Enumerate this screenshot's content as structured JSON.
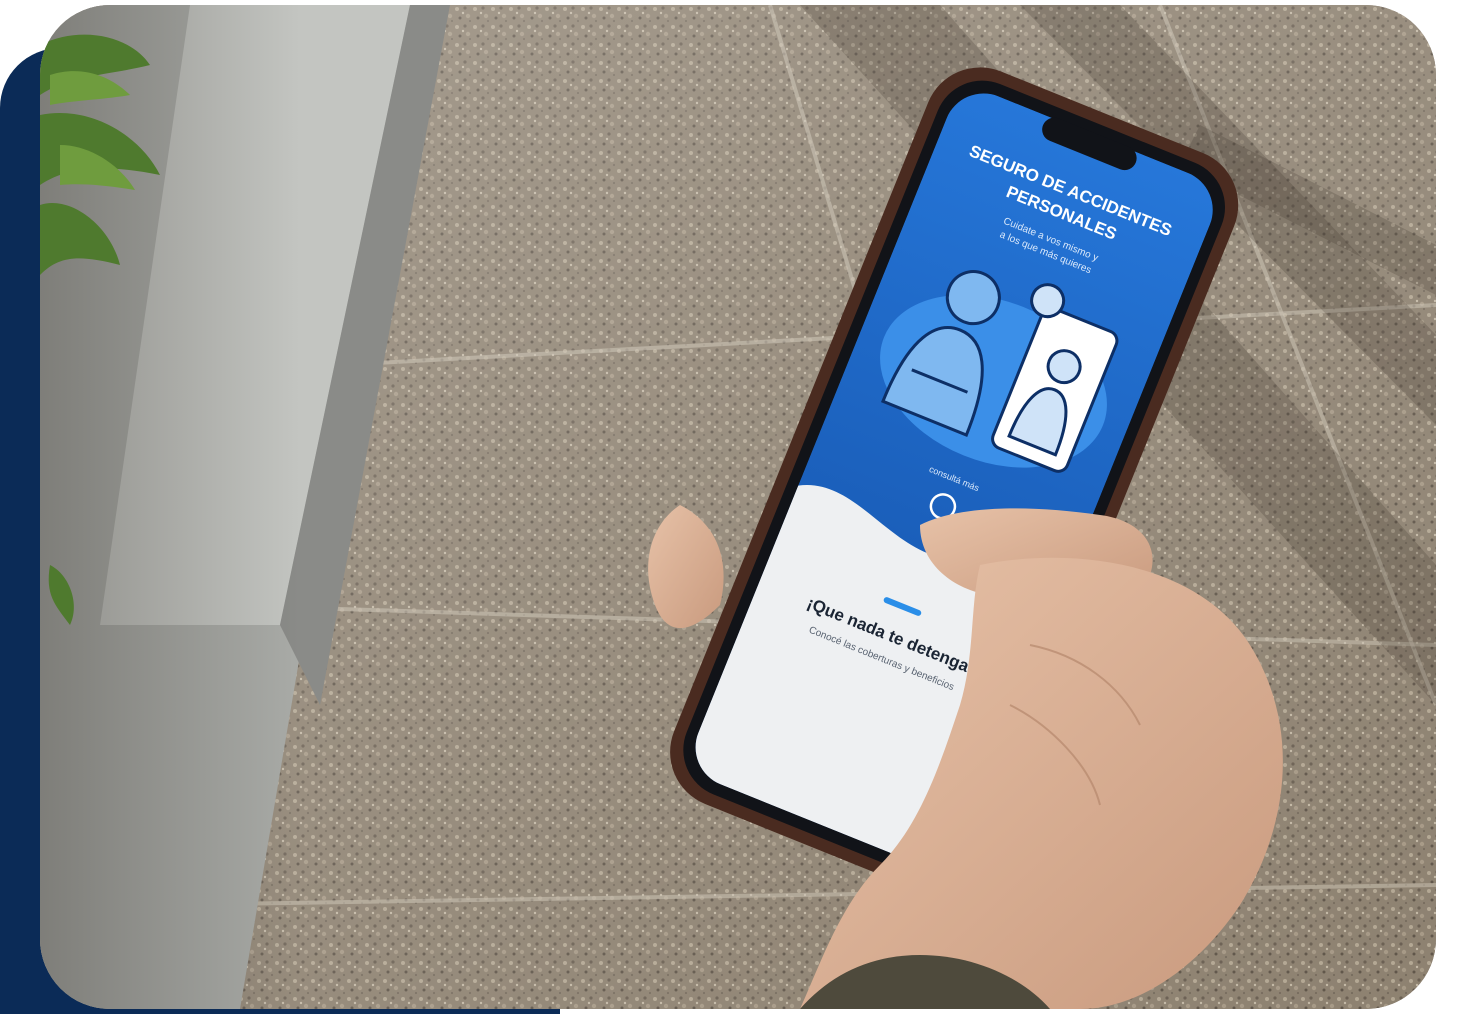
{
  "photo": {
    "subject": "hand-holding-smartphone",
    "setting": "stone-paved-sidewalk"
  },
  "phone_screen": {
    "title_line1": "SEGURO DE ACCIDENTES",
    "title_line2": "PERSONALES",
    "subtitle_line1": "Cuidate a vos mismo y",
    "subtitle_line2": "a los que más quieres",
    "button_caption": "consultá más",
    "card_heading": "¡Que nada te detenga!",
    "card_body": "Conocé las coberturas y beneficios"
  },
  "colors": {
    "navy_backdrop": "#0b2b57",
    "screen_blue": "#1f6fd1",
    "screen_blue_dark": "#144fa8",
    "card_background": "#eef0f2",
    "accent_dash": "#2a8ee8"
  }
}
